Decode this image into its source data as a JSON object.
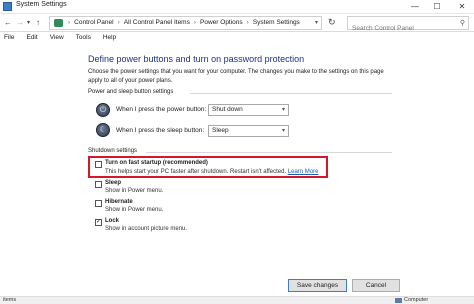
{
  "window": {
    "title": "System Settings",
    "controls": {
      "minimize": "—",
      "maximize": "☐",
      "close": "✕"
    }
  },
  "address": {
    "crumbs": [
      "Control Panel",
      "All Control Panel Items",
      "Power Options",
      "System Settings"
    ],
    "separator": "›",
    "search_placeholder": "Search Control Panel"
  },
  "menu": [
    "File",
    "Edit",
    "View",
    "Tools",
    "Help"
  ],
  "main": {
    "heading": "Define power buttons and turn on password protection",
    "description": "Choose the power settings that you want for your computer. The changes you make to the settings on this page apply to all of your power plans.",
    "power_group_label": "Power and sleep button settings",
    "power_button_label": "When I press the power button:",
    "power_button_value": "Shut down",
    "sleep_button_label": "When I press the sleep button:",
    "sleep_button_value": "Sleep",
    "shutdown_group_label": "Shutdown settings",
    "options": [
      {
        "label": "Turn on fast startup (recommended)",
        "desc": "This helps start your PC faster after shutdown. Restart isn't affected.",
        "link": "Learn More",
        "checked": false
      },
      {
        "label": "Sleep",
        "desc": "Show in Power menu.",
        "checked": false
      },
      {
        "label": "Hibernate",
        "desc": "Show in Power menu.",
        "checked": false
      },
      {
        "label": "Lock",
        "desc": "Show in account picture menu.",
        "checked": true
      }
    ]
  },
  "buttons": {
    "save": "Save changes",
    "cancel": "Cancel"
  },
  "status": {
    "items": "items",
    "computer": "Computer"
  },
  "colors": {
    "heading": "#1e3287",
    "highlight": "#d6172b",
    "link": "#1a5fb4"
  }
}
